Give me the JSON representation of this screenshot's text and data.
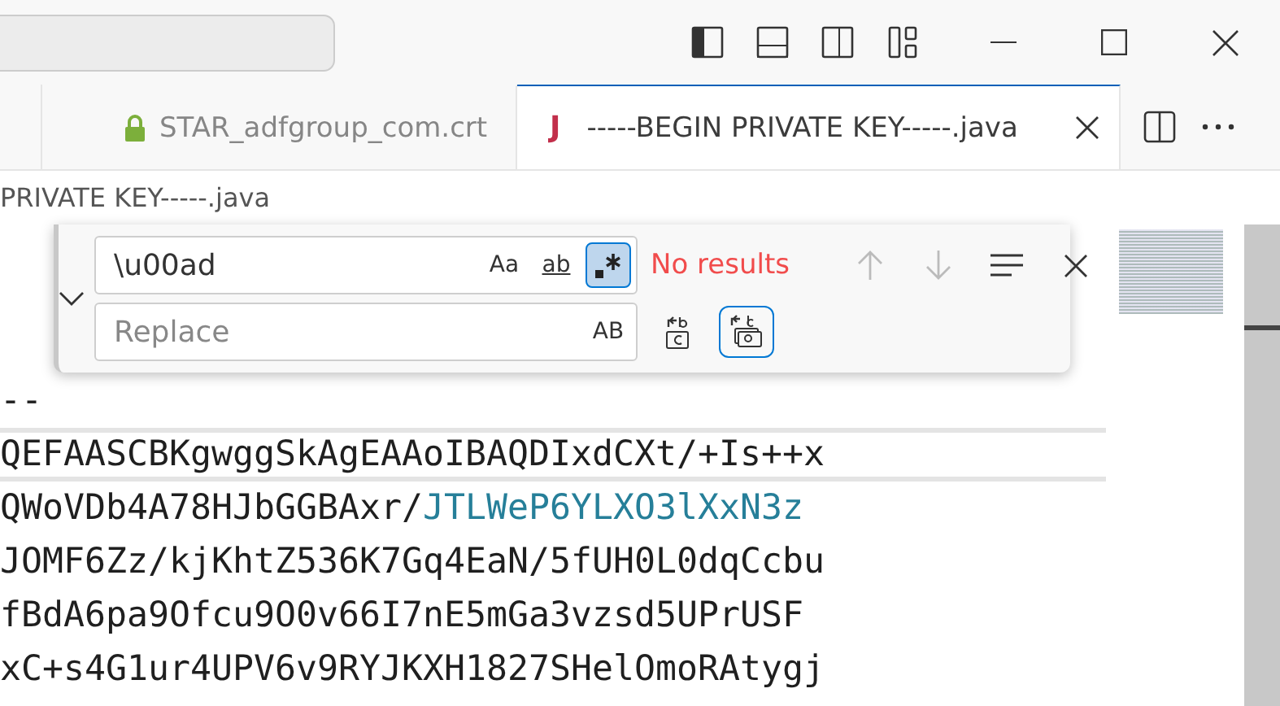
{
  "title_bar": {
    "layout_toggles": [
      {
        "kind": "primary-sidebar",
        "on": true
      },
      {
        "kind": "panel",
        "on": false
      },
      {
        "kind": "secondary-sidebar",
        "on": false
      },
      {
        "kind": "customize",
        "on": false
      }
    ]
  },
  "tabs": [
    {
      "label": "STAR_adfgroup_com.crt",
      "kind": "lock",
      "selected": false
    },
    {
      "label": "-----BEGIN PRIVATE KEY-----.java",
      "kind": "java",
      "icon_text": "J",
      "selected": true
    }
  ],
  "breadcrumb": "PRIVATE KEY-----.java",
  "find": {
    "expanded": true,
    "query": "\\u00ad",
    "options": [
      {
        "kind": "case",
        "label": "Aa",
        "on": false
      },
      {
        "kind": "word",
        "label": "ab",
        "on": false
      },
      {
        "kind": "regex",
        "on": true
      }
    ],
    "status": "No results",
    "replace_placeholder": "Replace",
    "preserve_case_label": "AB"
  },
  "code_lines": [
    {
      "current": false,
      "segments": [
        {
          "text": "--",
          "kind": "plain"
        }
      ]
    },
    {
      "current": true,
      "segments": [
        {
          "text": "QEFAASCBKgwggSkAgEAAoIBAQDIxdCXt/+Is++x",
          "kind": "plain"
        }
      ]
    },
    {
      "current": false,
      "segments": [
        {
          "text": "QWoVDb4A78HJbGGBAxr/",
          "kind": "plain"
        },
        {
          "text": "JTLWeP6YLXO3lXxN3z",
          "kind": "highlighted"
        }
      ]
    },
    {
      "current": false,
      "segments": [
        {
          "text": "JOMF6Zz/kjKhtZ536K7Gq4EaN/5fUH0L0dqCcbu",
          "kind": "plain"
        }
      ]
    },
    {
      "current": false,
      "segments": [
        {
          "text": "fBdA6pa9Ofcu9O0v66I7nE5mGa3vzsd5UPrUSF",
          "kind": "plain"
        }
      ]
    },
    {
      "current": false,
      "segments": [
        {
          "text": "xC+s4G1ur4UPV6v9RYJKXH1827SHelOmoRAtygj",
          "kind": "plain"
        }
      ]
    }
  ]
}
